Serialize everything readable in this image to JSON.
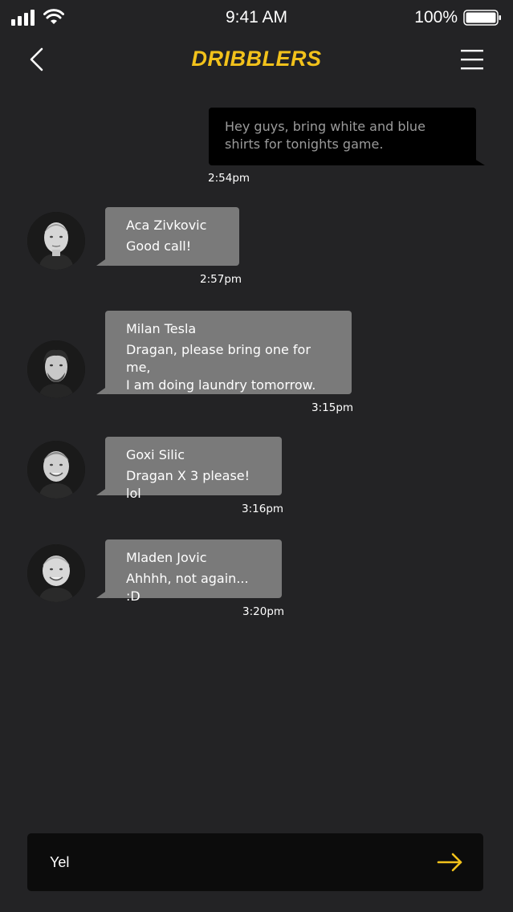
{
  "status_bar": {
    "time": "9:41 AM",
    "battery_percent": "100%",
    "signal_icon": "signal-bars-icon",
    "wifi_icon": "wifi-icon",
    "battery_icon": "battery-icon"
  },
  "nav": {
    "title": "DRIBBLERS",
    "back_icon": "chevron-left-icon",
    "menu_icon": "hamburger-menu-icon",
    "accent_color": "#f2c21b"
  },
  "messages": {
    "outgoing": {
      "text": "Hey guys, bring white and blue shirts for tonights game.",
      "time": "2:54pm"
    },
    "incoming": [
      {
        "sender": "Aca Zivkovic",
        "text": "Good call!",
        "time": "2:57pm"
      },
      {
        "sender": "Milan Tesla",
        "text": "Dragan, please bring one for me,\nI am doing laundry tomorrow.",
        "time": "3:15pm"
      },
      {
        "sender": "Goxi Silic",
        "text": "Dragan X 3 please! lol",
        "time": "3:16pm"
      },
      {
        "sender": "Mladen Jovic",
        "text": "Ahhhh, not again... :D",
        "time": "3:20pm"
      }
    ]
  },
  "composer": {
    "value": "Yel",
    "send_icon": "arrow-right-icon"
  },
  "colors": {
    "background": "#232325",
    "outgoing_bubble": "#000000",
    "incoming_bubble": "#7a7a7a"
  }
}
